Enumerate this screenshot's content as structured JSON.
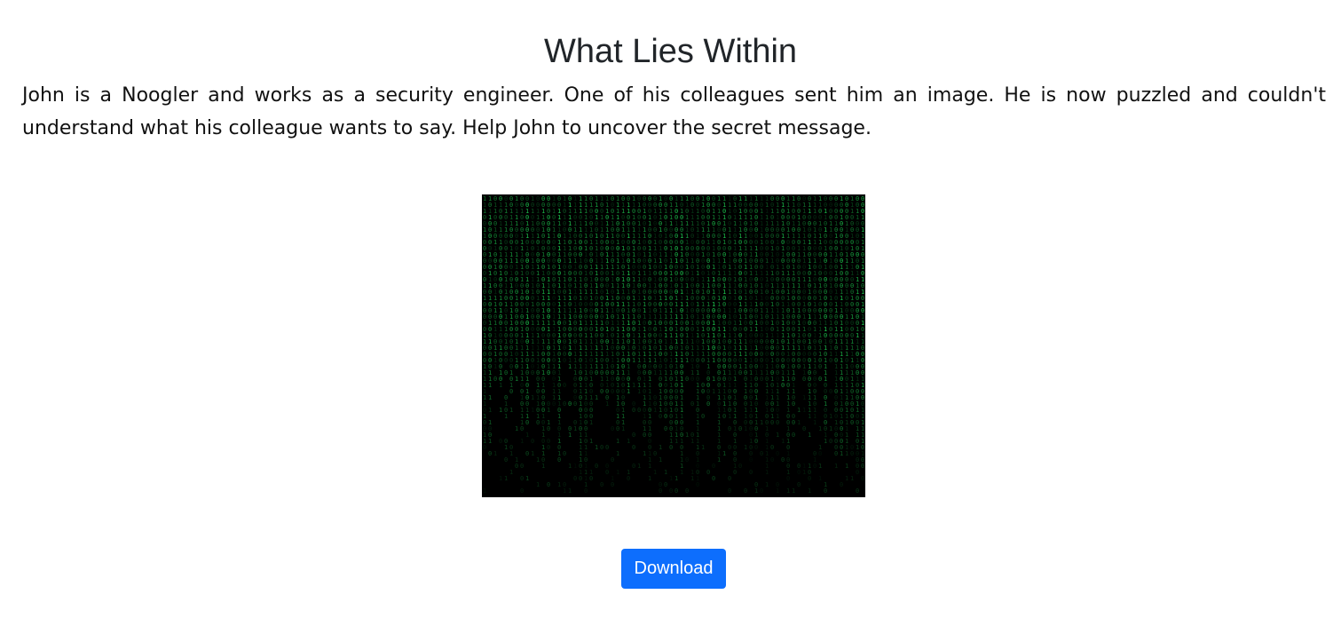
{
  "page": {
    "title": "What Lies Within",
    "description": "John is a Noogler and works as a security engineer. One of his colleagues sent him an image. He is now puzzled and couldn't understand what his colleague wants to say. Help John to uncover the secret message."
  },
  "image": {
    "icon": "matrix-binary-rain-image",
    "colors": {
      "background": "#000000",
      "glyph": "#1fd655",
      "glyph_dim": "#0b6b2a"
    }
  },
  "actions": {
    "download_label": "Download"
  },
  "colors": {
    "accent": "#0d6efd"
  }
}
